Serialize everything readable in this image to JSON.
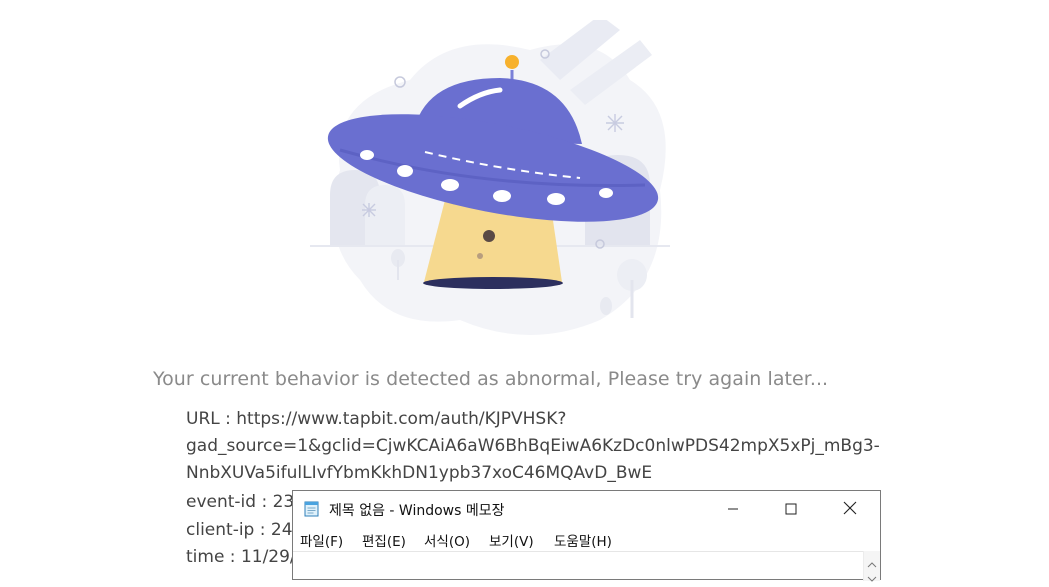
{
  "message": {
    "headline": "Your current behavior is detected as abnormal, Please try again later...",
    "url_line1": "URL : https://www.tapbit.com/auth/KJPVHSK?",
    "url_line2": "gad_source=1&gclid=CjwKCAiA6aW6BhBqEiwA6KzDc0nlwPDS42mpX5xPj_mBg3-",
    "url_line3": "NnbXUVa5ifulLIvfYbmKkhDN1ypb37xoC46MQAvD_BwE",
    "event_id": "event-id : 23",
    "client_ip": "client-ip : 24.",
    "time": "time : 11/29/"
  },
  "illustration": {
    "icon": "ufo-illustration",
    "accent": "#6a6fd0",
    "beam": "#f6d98f"
  },
  "notepad": {
    "title": "제목 없음 - Windows 메모장",
    "app_icon": "notepad-icon",
    "controls": {
      "minimize": "minimize-icon",
      "maximize": "maximize-icon",
      "close": "close-icon"
    },
    "menu": [
      "파일(F)",
      "편집(E)",
      "서식(O)",
      "보기(V)",
      "도움말(H)"
    ]
  }
}
